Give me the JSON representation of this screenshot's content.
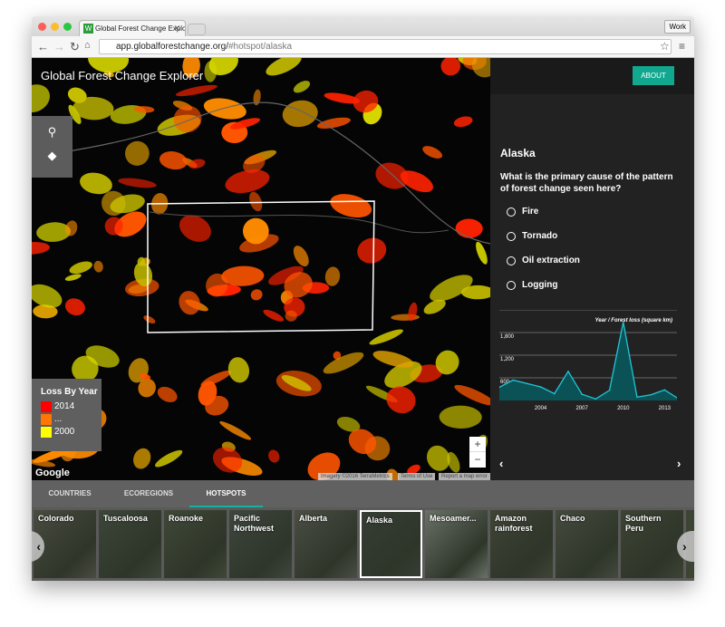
{
  "browser": {
    "tab_title": "Global Forest Change Explo",
    "work_label": "Work",
    "url_host": "app.globalforestchange.org/",
    "url_path": "#hotspot/alaska"
  },
  "app": {
    "title": "Global Forest Change Explorer",
    "about_label": "ABOUT"
  },
  "map": {
    "legend": {
      "title": "Loss By Year",
      "items": [
        {
          "label": "2014",
          "color": "#ff0000"
        },
        {
          "label": "...",
          "color": "#ff7700"
        },
        {
          "label": "2000",
          "color": "#ffff00"
        }
      ]
    },
    "zoom_in": "+",
    "zoom_out": "−",
    "google": "Google",
    "attribution": [
      "Imagery ©2016 TerraMetrics",
      "Terms of Use",
      "Report a map error"
    ]
  },
  "panel": {
    "region": "Alaska",
    "question": "What is the primary cause of the pattern of forest change seen here?",
    "options": [
      "Fire",
      "Tornado",
      "Oil extraction",
      "Logging"
    ]
  },
  "chart_data": {
    "type": "area",
    "title": "Year / Forest loss (square km)",
    "x": [
      2001,
      2002,
      2003,
      2004,
      2005,
      2006,
      2007,
      2008,
      2009,
      2010,
      2011,
      2012,
      2013,
      2014
    ],
    "values": [
      350,
      540,
      450,
      360,
      180,
      770,
      165,
      40,
      270,
      2075,
      90,
      150,
      280,
      50
    ],
    "x_ticks": [
      "2004",
      "2007",
      "2010",
      "2013"
    ],
    "y_ticks": [
      "600",
      "1,200",
      "1,800"
    ],
    "ylim": [
      0,
      2100
    ],
    "color": "#1fc6d6",
    "fill": "#0b5256"
  },
  "categories": {
    "tabs": [
      "COUNTRIES",
      "ECOREGIONS",
      "HOTSPOTS"
    ],
    "active": "HOTSPOTS"
  },
  "hotspots": {
    "items": [
      "Colorado",
      "Tuscaloosa",
      "Roanoke",
      "Pacific Northwest",
      "Alberta",
      "Alaska",
      "Mesoamer...",
      "Amazon rainforest",
      "Chaco",
      "Southern Peru"
    ],
    "selected": "Alaska"
  }
}
